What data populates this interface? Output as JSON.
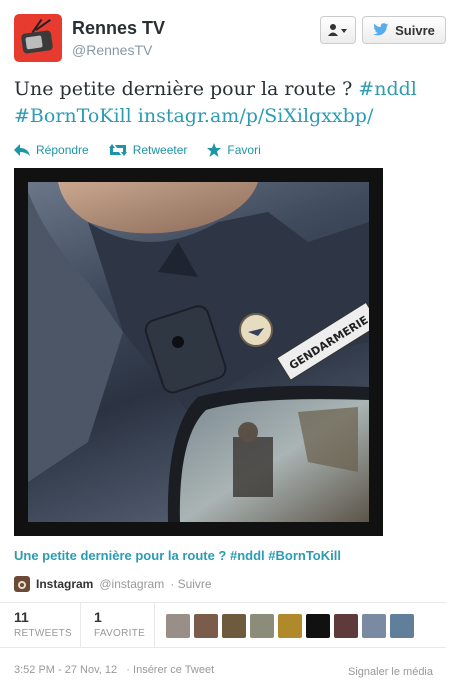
{
  "profile": {
    "name": "Rennes TV",
    "handle": "@RennesTV",
    "follow_label": "Suivre",
    "avatar_color": "#e63b2e"
  },
  "tweet": {
    "text_prefix": "Une petite dernière pour la route ? ",
    "hashtag1": "#nddl",
    "hashtag2": "#BornToKill",
    "link": "instagr.am/p/SiXilgxxbp/",
    "link_color": "#2b9cb3"
  },
  "actions": {
    "reply": "Répondre",
    "retweet": "Retweeter",
    "favorite": "Favori"
  },
  "media": {
    "patch_text": "GENDARMERIE",
    "caption": "Une petite dernière pour la route ? #nddl #BornToKill",
    "provider_name": "Instagram",
    "provider_handle": "@instagram",
    "provider_follow": "· Suivre"
  },
  "stats": {
    "retweets_count": "11",
    "retweets_label": "RETWEETS",
    "favorites_count": "1",
    "favorites_label": "FAVORITE",
    "avatar_colors": [
      "#9a8f88",
      "#7b5c4a",
      "#6e5a3c",
      "#8c8c7a",
      "#b08a2a",
      "#111111",
      "#5e3a3a",
      "#7a8aa2",
      "#5f7f9a"
    ]
  },
  "footer": {
    "timestamp": "3:52 PM - 27 Nov, 12",
    "embed": "· Insérer ce Tweet",
    "report": "Signaler le média"
  }
}
